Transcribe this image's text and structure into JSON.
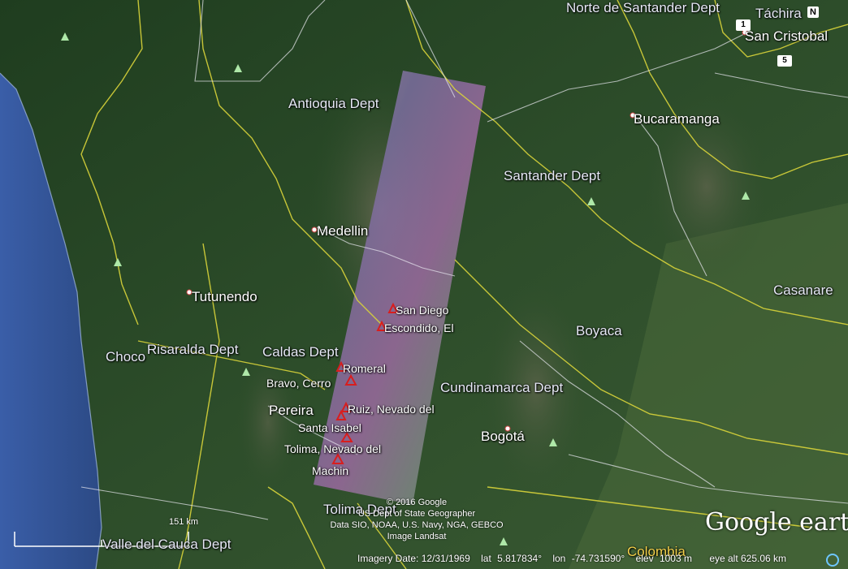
{
  "map": {
    "regions": [
      {
        "id": "norte-santander",
        "label": "Norte de Santander Dept"
      },
      {
        "id": "tachira",
        "label": "Táchira"
      },
      {
        "id": "antioquia",
        "label": "Antioquia Dept"
      },
      {
        "id": "santander",
        "label": "Santander Dept"
      },
      {
        "id": "casanare",
        "label": "Casanare"
      },
      {
        "id": "boyaca",
        "label": "Boyaca"
      },
      {
        "id": "choco",
        "label": "Choco"
      },
      {
        "id": "risaralda",
        "label": "Risaralda Dept"
      },
      {
        "id": "caldas",
        "label": "Caldas Dept"
      },
      {
        "id": "cundinamarca",
        "label": "Cundinamarca Dept"
      },
      {
        "id": "tolima",
        "label": "Tolima Dept"
      },
      {
        "id": "valle-cauca",
        "label": "Valle del Cauca Dept"
      },
      {
        "id": "colombia",
        "label": "Colombia"
      }
    ],
    "cities": [
      {
        "id": "san-cristobal",
        "label": "San Cristobal"
      },
      {
        "id": "bucaramanga",
        "label": "Bucaramanga"
      },
      {
        "id": "medellin",
        "label": "Medellin"
      },
      {
        "id": "tutunendo",
        "label": "Tutunendo"
      },
      {
        "id": "pereira",
        "label": "Pereira"
      },
      {
        "id": "bogota",
        "label": "Bogotá"
      }
    ],
    "volcanoes": [
      {
        "id": "san-diego",
        "label": "San Diego"
      },
      {
        "id": "escondido",
        "label": "Escondido, El"
      },
      {
        "id": "romeral",
        "label": "Romeral"
      },
      {
        "id": "bravo-cerro",
        "label": "Bravo, Cerro"
      },
      {
        "id": "ruiz",
        "label": "Ruiz, Nevado del"
      },
      {
        "id": "santa-isabel",
        "label": "Santa Isabel"
      },
      {
        "id": "tolima",
        "label": "Tolima, Nevado del"
      },
      {
        "id": "machin",
        "label": "Machin"
      }
    ],
    "road_shields": [
      "1",
      "5"
    ]
  },
  "credits": {
    "copyright": "© 2016 Google",
    "line2": "US Dept of State Geographer",
    "line3": "Data SIO, NOAA, U.S. Navy, NGA, GEBCO",
    "line4": "Image Landsat"
  },
  "branding": {
    "logo": "Google earth"
  },
  "scale": {
    "label": "151 km"
  },
  "status": {
    "imagery_date": "Imagery Date: 12/31/1969",
    "lat_label": "lat",
    "lat_value": "5.817834°",
    "lon_label": "lon",
    "lon_value": "-74.731590°",
    "elev_label": "elev",
    "elev_value": "1003 m",
    "eye_alt": "eye alt 625.06 km"
  },
  "navigation": {
    "north_indicator": "N"
  },
  "colors": {
    "border_yellow": "#d9d43a",
    "border_white": "#e8e8f0",
    "volcano_red": "#d81e1e",
    "ocean": "#2a4f8f",
    "land": "#2c4a28"
  },
  "icons": [
    "tree-icon",
    "volcano-icon",
    "city-dot-icon",
    "globe-icon",
    "north-icon"
  ]
}
